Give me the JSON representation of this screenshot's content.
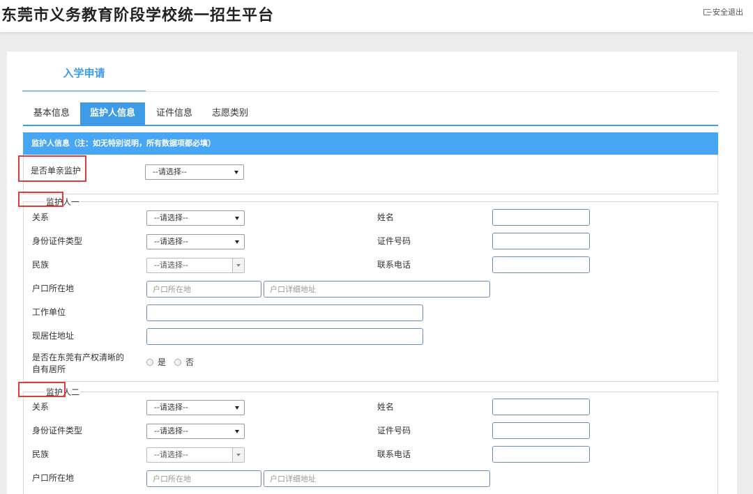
{
  "header": {
    "title": "东莞市义务教育阶段学校统一招生平台",
    "logout_label": "安全退出"
  },
  "page_tab": "入学申请",
  "subtabs": [
    "基本信息",
    "监护人信息",
    "证件信息",
    "志愿类别"
  ],
  "active_subtab": "监护人信息",
  "section_title": "监护人信息（注：如无特别说明，所有数据项都必填）",
  "single_parent": {
    "label": "是否单亲监护",
    "value": "--请选择--"
  },
  "guardian1": {
    "legend": "监护人一",
    "relation_label": "关系",
    "relation_value": "--请选择--",
    "name_label": "姓名",
    "id_type_label": "身份证件类型",
    "id_type_value": "--请选择--",
    "id_number_label": "证件号码",
    "ethnicity_label": "民族",
    "ethnicity_value": "--请选择--",
    "phone_label": "联系电话",
    "hukou_label": "户口所在地",
    "hukou_placeholder": "户口所在地",
    "hukou_detail_placeholder": "户口详细地址",
    "employer_label": "工作单位",
    "address_label": "现居住地址",
    "property_label": "是否在东莞有产权清晰的自有居所",
    "yes_label": "是",
    "no_label": "否"
  },
  "guardian2": {
    "legend": "监护人二",
    "relation_label": "关系",
    "relation_value": "--请选择--",
    "name_label": "姓名",
    "id_type_label": "身份证件类型",
    "id_type_value": "--请选择--",
    "id_number_label": "证件号码",
    "ethnicity_label": "民族",
    "ethnicity_value": "--请选择--",
    "phone_label": "联系电话",
    "hukou_label": "户口所在地",
    "hukou_placeholder": "户口所在地",
    "hukou_detail_placeholder": "户口详细地址"
  },
  "colors": {
    "accent": "#3e9be8",
    "section_header": "#47a7f5",
    "highlight_box": "#e03a3a"
  }
}
